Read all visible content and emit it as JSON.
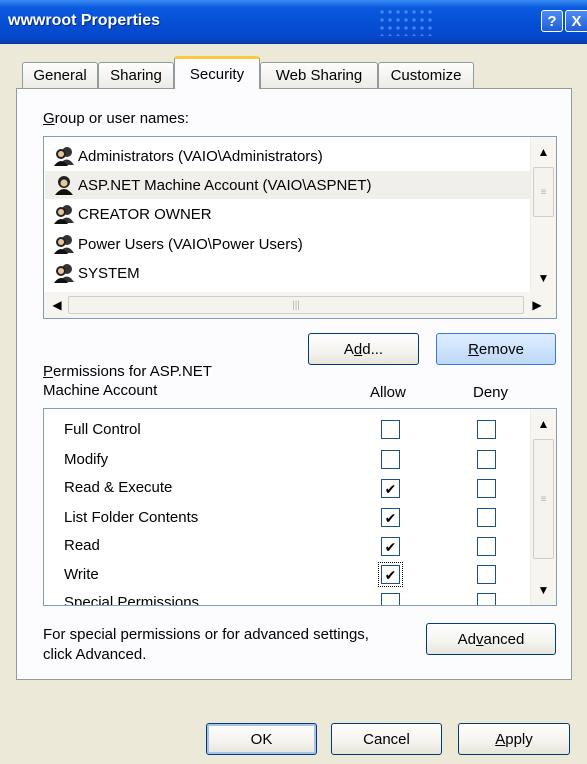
{
  "window": {
    "title": "wwwroot Properties",
    "help_glyph": "?",
    "close_glyph": "X"
  },
  "tabs": [
    {
      "label": "General"
    },
    {
      "label": "Sharing"
    },
    {
      "label": "Security",
      "active": true
    },
    {
      "label": "Web Sharing"
    },
    {
      "label": "Customize"
    }
  ],
  "users": {
    "label_prefix": "G",
    "label_rest": "roup or user names:",
    "items": [
      {
        "name": "Administrators (VAIO\\Administrators)",
        "icon": "group-icon"
      },
      {
        "name": "ASP.NET Machine Account (VAIO\\ASPNET)",
        "icon": "user-icon",
        "selected": true
      },
      {
        "name": "CREATOR OWNER",
        "icon": "group-icon"
      },
      {
        "name": "Power Users (VAIO\\Power Users)",
        "icon": "group-icon"
      },
      {
        "name": "SYSTEM",
        "icon": "group-icon"
      }
    ]
  },
  "buttons": {
    "add": {
      "pre": "A",
      "u": "d",
      "post": "d..."
    },
    "remove": {
      "pre": "",
      "u": "R",
      "post": "emove"
    },
    "advanced": {
      "pre": "Ad",
      "u": "v",
      "post": "anced"
    },
    "ok": "OK",
    "cancel": "Cancel",
    "apply": {
      "pre": "",
      "u": "A",
      "post": "pply"
    }
  },
  "permissions": {
    "title_u": "P",
    "title_line1_rest": "ermissions for ASP.NET",
    "title_line2": "Machine Account",
    "allow_header": "Allow",
    "deny_header": "Deny",
    "items": [
      {
        "name": "Full Control",
        "allow": false,
        "deny": false
      },
      {
        "name": "Modify",
        "allow": false,
        "deny": false
      },
      {
        "name": "Read & Execute",
        "allow": true,
        "deny": false
      },
      {
        "name": "List Folder Contents",
        "allow": true,
        "deny": false
      },
      {
        "name": "Read",
        "allow": true,
        "deny": false
      },
      {
        "name": "Write",
        "allow": true,
        "deny": false
      },
      {
        "name": "Special Permissions",
        "allow": false,
        "deny": false
      }
    ]
  },
  "advanced_note": {
    "line1": "For special permissions or for advanced settings,",
    "line2": "click Advanced."
  },
  "glyphs": {
    "check": "✔",
    "up": "▲",
    "down": "▼",
    "left": "◀",
    "right": "▶",
    "grip_v": "≡",
    "grip_h": "|||"
  },
  "colors": {
    "titlebar": "#0550d6",
    "accent_tab": "#ffc83c",
    "face": "#ece9d8",
    "selection": "#f0efeb"
  }
}
